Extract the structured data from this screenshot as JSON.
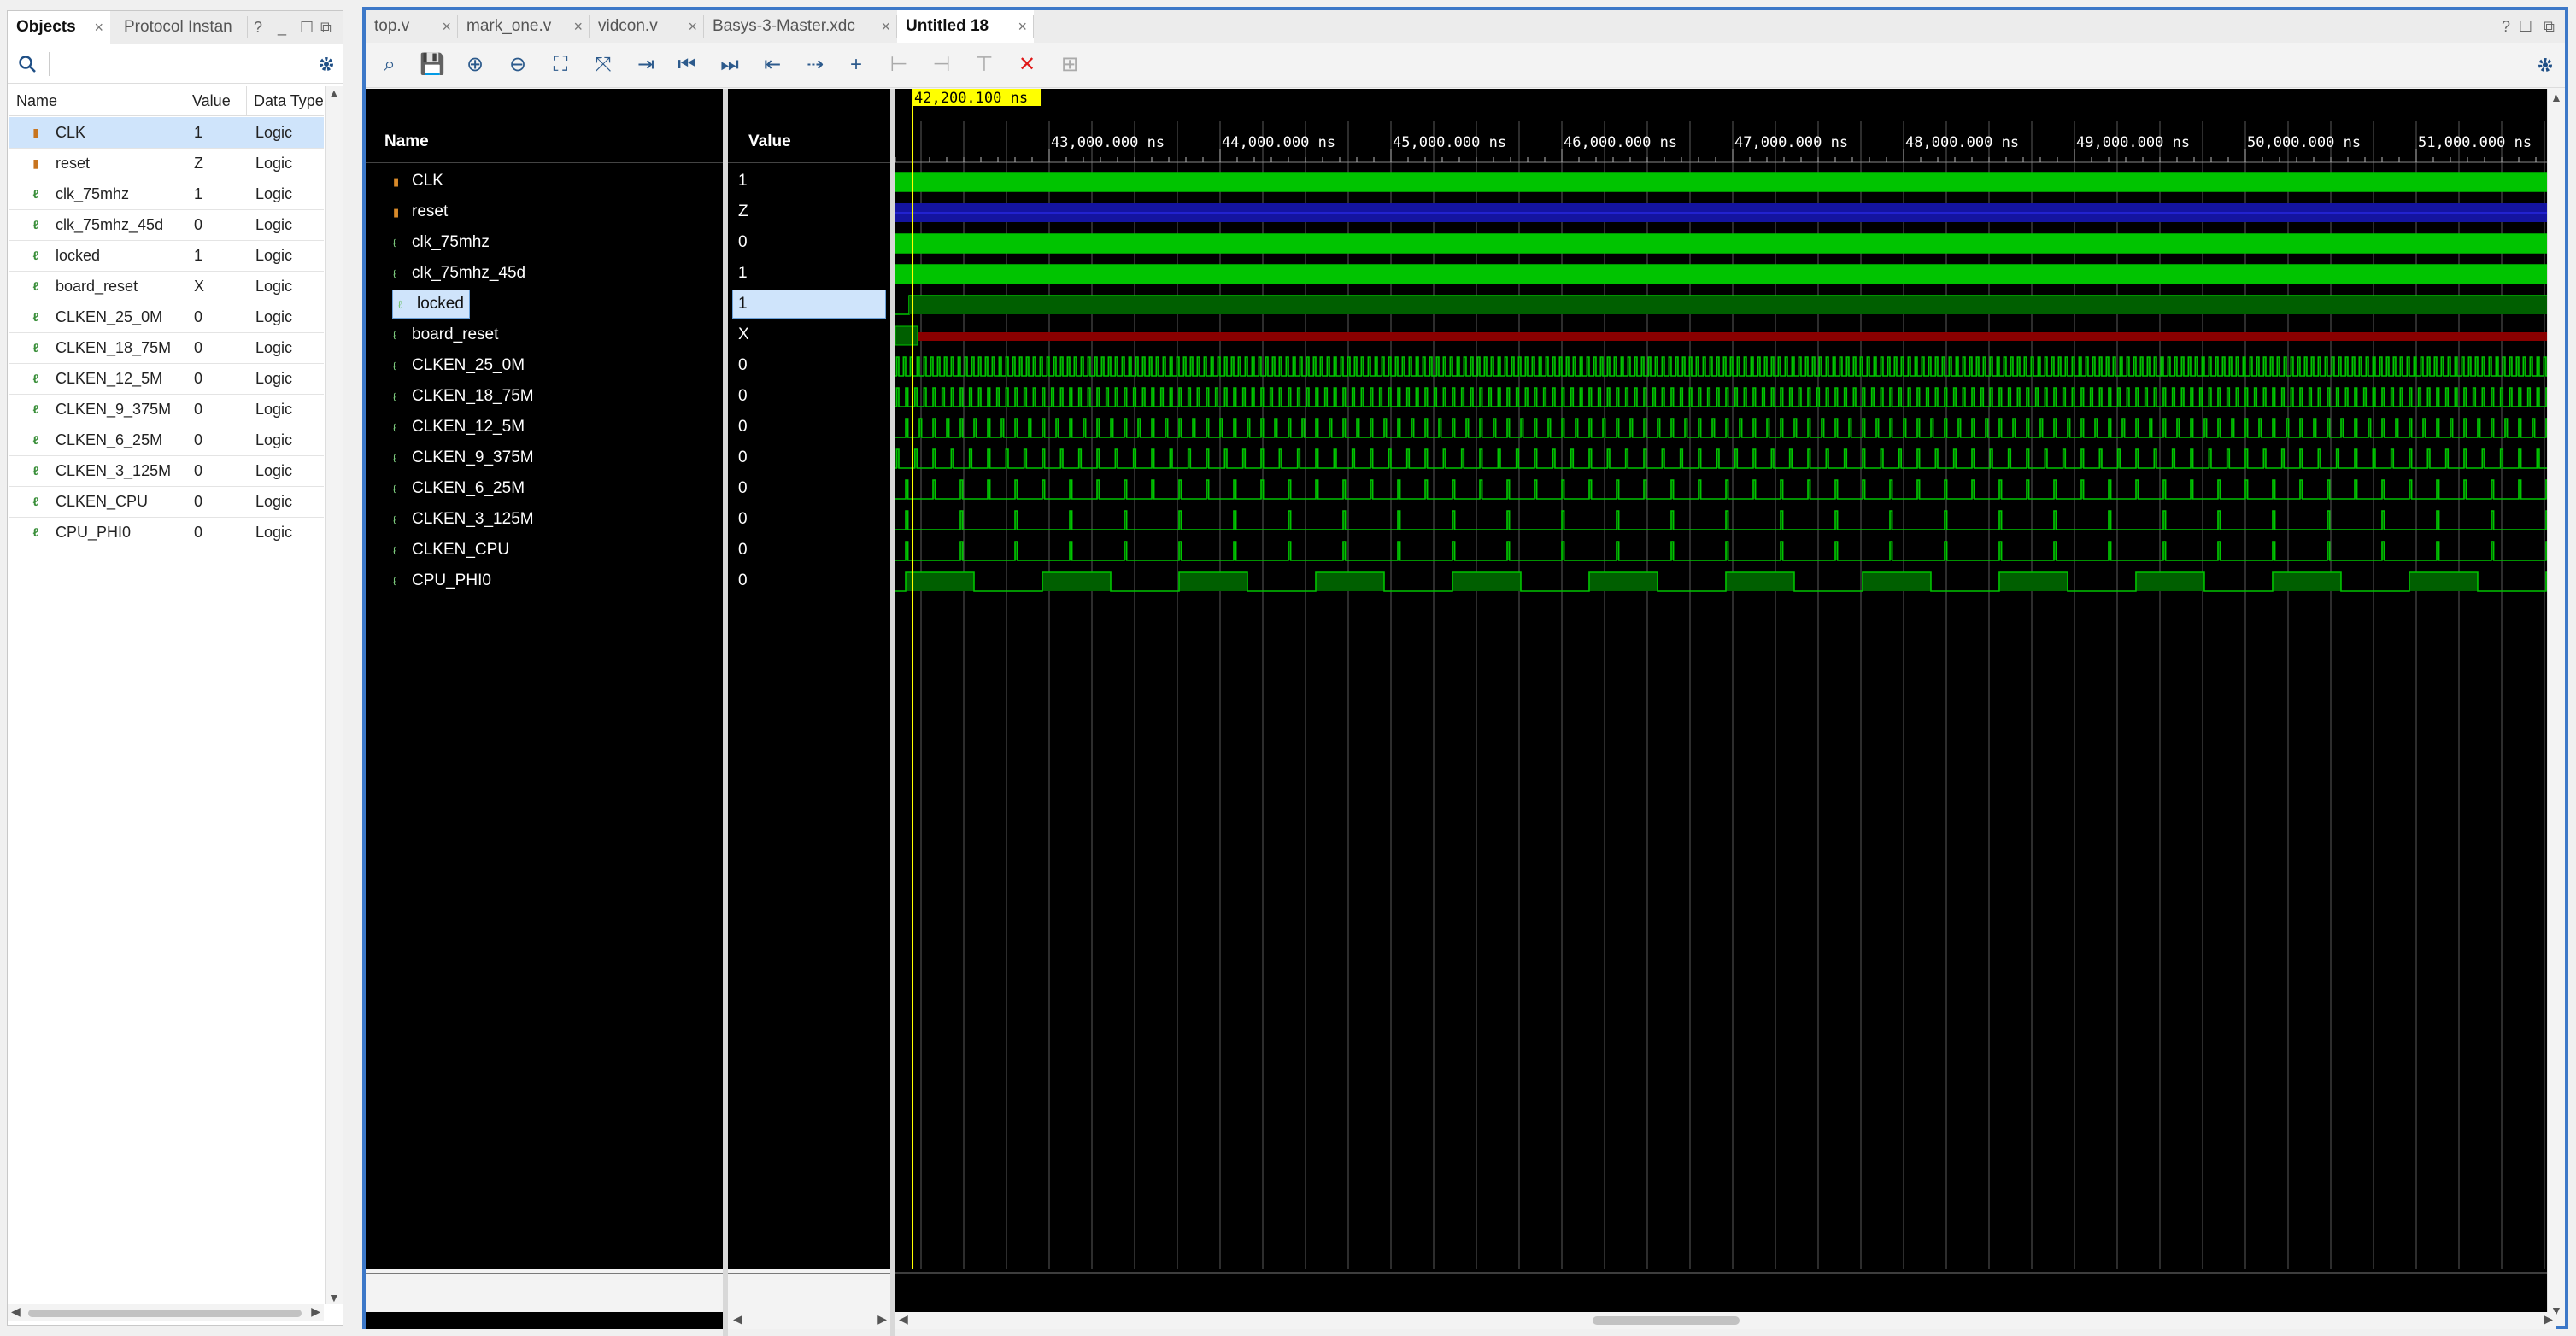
{
  "objects": {
    "tabs": [
      {
        "label": "Objects",
        "active": true
      },
      {
        "label": "Protocol Instan",
        "active": false
      }
    ],
    "panel_controls": [
      "?",
      "_",
      "☐",
      "⧉"
    ],
    "search_icon": "search-icon",
    "settings_icon": "gear-icon",
    "columns": [
      "Name",
      "Value",
      "Data Type"
    ],
    "rows": [
      {
        "name": "CLK",
        "value": "1",
        "type": "Logic",
        "kind": "in",
        "selected": true
      },
      {
        "name": "reset",
        "value": "Z",
        "type": "Logic",
        "kind": "in"
      },
      {
        "name": "clk_75mhz",
        "value": "1",
        "type": "Logic",
        "kind": "int"
      },
      {
        "name": "clk_75mhz_45d",
        "value": "0",
        "type": "Logic",
        "kind": "int"
      },
      {
        "name": "locked",
        "value": "1",
        "type": "Logic",
        "kind": "int"
      },
      {
        "name": "board_reset",
        "value": "X",
        "type": "Logic",
        "kind": "int"
      },
      {
        "name": "CLKEN_25_0M",
        "value": "0",
        "type": "Logic",
        "kind": "int"
      },
      {
        "name": "CLKEN_18_75M",
        "value": "0",
        "type": "Logic",
        "kind": "int"
      },
      {
        "name": "CLKEN_12_5M",
        "value": "0",
        "type": "Logic",
        "kind": "int"
      },
      {
        "name": "CLKEN_9_375M",
        "value": "0",
        "type": "Logic",
        "kind": "int"
      },
      {
        "name": "CLKEN_6_25M",
        "value": "0",
        "type": "Logic",
        "kind": "int"
      },
      {
        "name": "CLKEN_3_125M",
        "value": "0",
        "type": "Logic",
        "kind": "int"
      },
      {
        "name": "CLKEN_CPU",
        "value": "0",
        "type": "Logic",
        "kind": "int"
      },
      {
        "name": "CPU_PHI0",
        "value": "0",
        "type": "Logic",
        "kind": "int"
      }
    ]
  },
  "editor_tabs": [
    {
      "label": "top.v",
      "active": false
    },
    {
      "label": "mark_one.v",
      "active": false
    },
    {
      "label": "vidcon.v",
      "active": false
    },
    {
      "label": "Basys-3-Master.xdc",
      "active": false
    },
    {
      "label": "Untitled 18",
      "active": true
    }
  ],
  "window_controls": [
    "?",
    "☐",
    "⧉"
  ],
  "toolbar": [
    {
      "icon": "search-icon",
      "glyph": "⌕",
      "enabled": true
    },
    {
      "icon": "save-icon",
      "glyph": "💾",
      "enabled": true
    },
    {
      "icon": "zoom-in-icon",
      "glyph": "⊕",
      "enabled": true
    },
    {
      "icon": "zoom-out-icon",
      "glyph": "⊖",
      "enabled": true
    },
    {
      "icon": "zoom-fit-icon",
      "glyph": "⛶",
      "enabled": true
    },
    {
      "icon": "zoom-to-cursor-icon",
      "glyph": "⤧",
      "enabled": true
    },
    {
      "icon": "go-to-time-icon",
      "glyph": "⇥",
      "enabled": true
    },
    {
      "icon": "go-to-start-icon",
      "glyph": "⏮",
      "enabled": true
    },
    {
      "icon": "go-to-end-icon",
      "glyph": "⏭",
      "enabled": true
    },
    {
      "icon": "previous-transition-icon",
      "glyph": "⇤",
      "enabled": true
    },
    {
      "icon": "next-transition-icon",
      "glyph": "⇢",
      "enabled": true
    },
    {
      "icon": "add-marker-icon",
      "glyph": "+",
      "enabled": true
    },
    {
      "icon": "previous-marker-icon",
      "glyph": "⊢",
      "enabled": false
    },
    {
      "icon": "next-marker-icon",
      "glyph": "⊣",
      "enabled": false
    },
    {
      "icon": "swap-cursors-icon",
      "glyph": "⊤",
      "enabled": false
    },
    {
      "icon": "delete-markers-icon",
      "glyph": "✕",
      "enabled": true,
      "color": "#e01818"
    },
    {
      "icon": "snap-to-transition-icon",
      "glyph": "⊞",
      "enabled": false
    }
  ],
  "waveform": {
    "name_header": "Name",
    "value_header": "Value",
    "cursor_time": "42,200.100 ns",
    "time_labels": [
      "43,000.000 ns",
      "44,000.000 ns",
      "45,000.000 ns",
      "46,000.000 ns",
      "47,000.000 ns",
      "48,000.000 ns",
      "49,000.000 ns",
      "50,000.000 ns",
      "51,000.000 ns"
    ],
    "signals": [
      {
        "name": "CLK",
        "value": "1",
        "kind": "in",
        "wave": "clock"
      },
      {
        "name": "reset",
        "value": "Z",
        "kind": "in",
        "wave": "highz"
      },
      {
        "name": "clk_75mhz",
        "value": "0",
        "kind": "int",
        "wave": "clock"
      },
      {
        "name": "clk_75mhz_45d",
        "value": "1",
        "kind": "int",
        "wave": "clock"
      },
      {
        "name": "locked",
        "value": "1",
        "kind": "int",
        "wave": "high",
        "selected": true
      },
      {
        "name": "board_reset",
        "value": "X",
        "kind": "int",
        "wave": "unknown"
      },
      {
        "name": "CLKEN_25_0M",
        "value": "0",
        "kind": "int",
        "wave": "pulse",
        "divisor": 3
      },
      {
        "name": "CLKEN_18_75M",
        "value": "0",
        "kind": "int",
        "wave": "pulse",
        "divisor": 4
      },
      {
        "name": "CLKEN_12_5M",
        "value": "0",
        "kind": "int",
        "wave": "pulse",
        "divisor": 6
      },
      {
        "name": "CLKEN_9_375M",
        "value": "0",
        "kind": "int",
        "wave": "pulse",
        "divisor": 8
      },
      {
        "name": "CLKEN_6_25M",
        "value": "0",
        "kind": "int",
        "wave": "pulse",
        "divisor": 12
      },
      {
        "name": "CLKEN_3_125M",
        "value": "0",
        "kind": "int",
        "wave": "pulse",
        "divisor": 24
      },
      {
        "name": "CLKEN_CPU",
        "value": "0",
        "kind": "int",
        "wave": "pulse",
        "divisor": 24
      },
      {
        "name": "CPU_PHI0",
        "value": "0",
        "kind": "int",
        "wave": "phase",
        "divisor": 24
      }
    ]
  },
  "colors": {
    "wave": "#00c400",
    "wave_fill": "#005f00",
    "highz": "#1414a0",
    "unknown": "#8a0000",
    "cursor": "#ffff00",
    "selection": "#cfe4fb"
  }
}
